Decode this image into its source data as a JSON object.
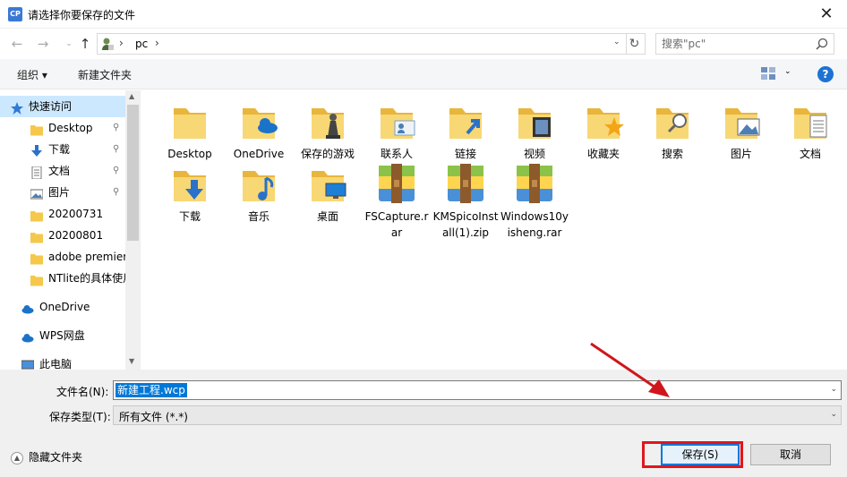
{
  "window": {
    "title": "请选择你要保存的文件",
    "close": "✕",
    "app_icon_text": "CP"
  },
  "nav": {
    "back": "←",
    "forward": "→",
    "up": "↑",
    "crumb": "pc",
    "crumb_sep": "›",
    "dropdown": "⌄",
    "refresh": "↻"
  },
  "search": {
    "placeholder": "搜索\"pc\""
  },
  "toolbar": {
    "organize": "组织 ▾",
    "new_folder": "新建文件夹",
    "help": "?"
  },
  "sidebar": {
    "items": [
      {
        "label": "快速访问",
        "icon": "star-icon",
        "pinned": false
      },
      {
        "label": "Desktop",
        "icon": "folder-icon",
        "pinned": true
      },
      {
        "label": "下载",
        "icon": "download-icon",
        "pinned": true
      },
      {
        "label": "文档",
        "icon": "document-icon",
        "pinned": true
      },
      {
        "label": "图片",
        "icon": "picture-icon",
        "pinned": true
      },
      {
        "label": "20200731",
        "icon": "folder-icon",
        "pinned": false
      },
      {
        "label": "20200801",
        "icon": "folder-icon",
        "pinned": false
      },
      {
        "label": "adobe premiere",
        "icon": "folder-icon",
        "pinned": false
      },
      {
        "label": "NTlite的具体使用",
        "icon": "folder-icon",
        "pinned": false
      },
      {
        "label": "OneDrive",
        "icon": "cloud-icon",
        "pinned": false
      },
      {
        "label": "WPS网盘",
        "icon": "cloud-icon",
        "pinned": false
      },
      {
        "label": "此电脑",
        "icon": "computer-icon",
        "pinned": false
      }
    ],
    "pin_glyph": "📌"
  },
  "files": [
    {
      "label": "Desktop",
      "kind": "folder"
    },
    {
      "label": "OneDrive",
      "kind": "folder-cloud"
    },
    {
      "label": "保存的游戏",
      "kind": "folder-game"
    },
    {
      "label": "联系人",
      "kind": "folder-contact"
    },
    {
      "label": "链接",
      "kind": "folder-link"
    },
    {
      "label": "视频",
      "kind": "folder-video"
    },
    {
      "label": "收藏夹",
      "kind": "folder-star"
    },
    {
      "label": "搜索",
      "kind": "folder-search"
    },
    {
      "label": "图片",
      "kind": "folder-picture"
    },
    {
      "label": "文档",
      "kind": "folder-doc"
    },
    {
      "label": "下载",
      "kind": "folder-download"
    },
    {
      "label": "音乐",
      "kind": "folder-music"
    },
    {
      "label": "桌面",
      "kind": "folder-desktop"
    },
    {
      "label": "FSCapture.rar",
      "kind": "archive"
    },
    {
      "label": "KMSpicoInstall(1).zip",
      "kind": "archive"
    },
    {
      "label": "Windows10yisheng.rar",
      "kind": "archive"
    }
  ],
  "form": {
    "filename_label": "文件名(N):",
    "filename_value": "新建工程.wcp",
    "filetype_label": "保存类型(T):",
    "filetype_value": "所有文件 (*.*)",
    "hide_folders": "隐藏文件夹",
    "save": "保存(S)",
    "cancel": "取消"
  },
  "colors": {
    "accent": "#0078d7",
    "highlight": "#e0161d",
    "folder": "#f8d775",
    "selection": "#cce8ff"
  }
}
